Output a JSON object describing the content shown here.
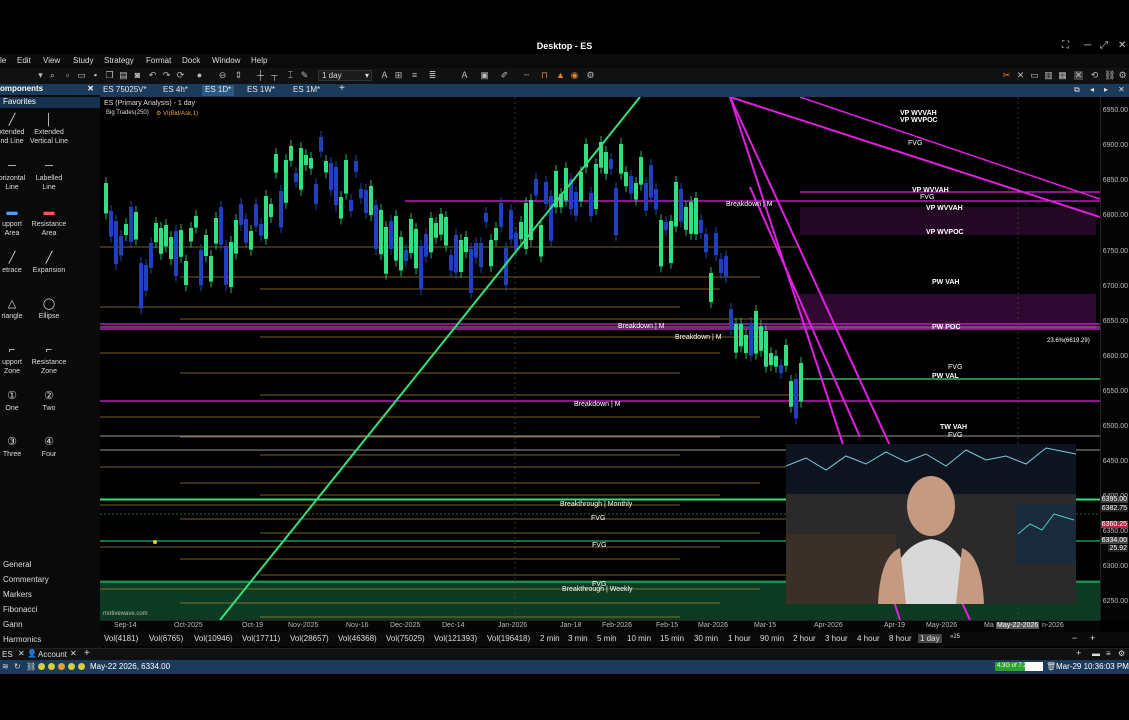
{
  "window": {
    "title": "Desktop - ES"
  },
  "menu": [
    "le",
    "Edit",
    "View",
    "Study",
    "Strategy",
    "Format",
    "Dock",
    "Window",
    "Help"
  ],
  "toolbar": {
    "timeframe": "1 day"
  },
  "tabs": [
    "ES 75025V*",
    "ES 4h*",
    "ES 1D*",
    "ES 1W*",
    "ES 1M*"
  ],
  "tab_add": "+",
  "components": {
    "header": "omponents",
    "favorites": "Favorites",
    "tools": [
      {
        "l1": "xtended",
        "l2": "nd Line",
        "icon": "╱"
      },
      {
        "l1": "Extended",
        "l2": "Vertical Line",
        "icon": "│"
      },
      {
        "l1": "orizontal",
        "l2": "Line",
        "icon": "─"
      },
      {
        "l1": "Labelled",
        "l2": "Line",
        "icon": "─"
      },
      {
        "l1": "upport",
        "l2": "Area",
        "icon": "▬"
      },
      {
        "l1": "Resistance",
        "l2": "Area",
        "icon": "▬"
      },
      {
        "l1": "etrace",
        "l2": "",
        "icon": "╱"
      },
      {
        "l1": "Expansion",
        "l2": "",
        "icon": "╱"
      },
      {
        "l1": "riangle",
        "l2": "",
        "icon": "△"
      },
      {
        "l1": "Ellipse",
        "l2": "",
        "icon": "◯"
      },
      {
        "l1": "upport",
        "l2": "Zone",
        "icon": "⌐"
      },
      {
        "l1": "Resistance",
        "l2": "Zone",
        "icon": "⌐"
      },
      {
        "l1": "One",
        "l2": "",
        "icon": "①"
      },
      {
        "l1": "Two",
        "l2": "",
        "icon": "②"
      },
      {
        "l1": "Three",
        "l2": "",
        "icon": "③"
      },
      {
        "l1": "Four",
        "l2": "",
        "icon": "④"
      }
    ],
    "categories": [
      "General",
      "Commentary",
      "Markers",
      "Fibonacci",
      "Gann",
      "Harmonics"
    ]
  },
  "chart": {
    "header": "ES (Primary Analysis) - 1 day",
    "indicator1": "Big Trades(250)",
    "indicator2": "VI(Bid/Ask,1)",
    "watermark": "motivewave.com",
    "price_labels": [
      "6950.00",
      "6900.00",
      "6850.00",
      "6800.00",
      "6750.00",
      "6700.00",
      "6650.00",
      "6600.00",
      "6550.00",
      "6500.00",
      "6450.00",
      "6400.00",
      "6350.00",
      "6300.00",
      "6250.00"
    ],
    "price_tags": [
      "6395.00",
      "6382.75",
      "6360.25",
      "6334.00",
      "25.92"
    ],
    "time_labels": [
      "Sep-14",
      "Oct-2025",
      "Oct-19",
      "Nov-2025",
      "Nov-16",
      "Dec-2025",
      "Dec-14",
      "Jan-2026",
      "Jan-18",
      "Feb-2026",
      "Feb-15",
      "Mar-2026",
      "Mar-15",
      "Apr-2026",
      "Apr-19",
      "May-2026",
      "Ma",
      "May-22-2026",
      "n-2026"
    ],
    "annotations": {
      "vp_wvvah_1": "VP WVVAH",
      "vp_wvpoc_1": "VP WVPOC",
      "fvg_1": "FVG",
      "vp_wvvah_2": "VP WVVAH",
      "fvg_2": "FVG",
      "vp_wvvah_3": "VP WVVAH",
      "vp_wvpoc_2": "VP WVPOC",
      "pw_vah": "PW VAH",
      "pw_poc": "PW POC",
      "fib": "23.6%(6619.29)",
      "fvg_3": "FVG",
      "pw_val": "PW VAL",
      "tw_vah": "TW VAH",
      "fvg_4": "FVG",
      "breakdown_m1": "Breakdown | M",
      "breakdown_m2": "Breakdown | M",
      "breakdown_m3": "Breakdown | M",
      "breakdown_m4": "Breakdown | M",
      "breakthrough_monthly": "Breakthrough | Monthly",
      "fvg_5": "FVG",
      "fvg_6": "FVG",
      "fvg_7": "FVG",
      "breakthrough_weekly": "Breakthrough | Weekly"
    }
  },
  "volumes": [
    "Vol(4181)",
    "Vol(6765)",
    "Vol(10946)",
    "Vol(17711)",
    "Vol(28657)",
    "Vol(46368)",
    "Vol(75025)",
    "Vol(121393)",
    "Vol(196418)"
  ],
  "timeframes": [
    "2 min",
    "3 min",
    "5 min",
    "10 min",
    "15 min",
    "30 min",
    "1 hour",
    "90 min",
    "2 hour",
    "3 hour",
    "4 hour",
    "8 hour",
    "1 day"
  ],
  "timeframe_more": "»25",
  "bottom": {
    "symbol": "ES",
    "account": "Account"
  },
  "status": {
    "cursor": "May-22 2026, 6334.00",
    "memory": "4.3G of 7.2G",
    "datetime": "Mar-29 10:36:03 PM"
  },
  "colors": {
    "accent": "#1c3a5a",
    "green_line": "#33e07a",
    "magenta": "#e020e0",
    "gold": "#c8a030"
  }
}
